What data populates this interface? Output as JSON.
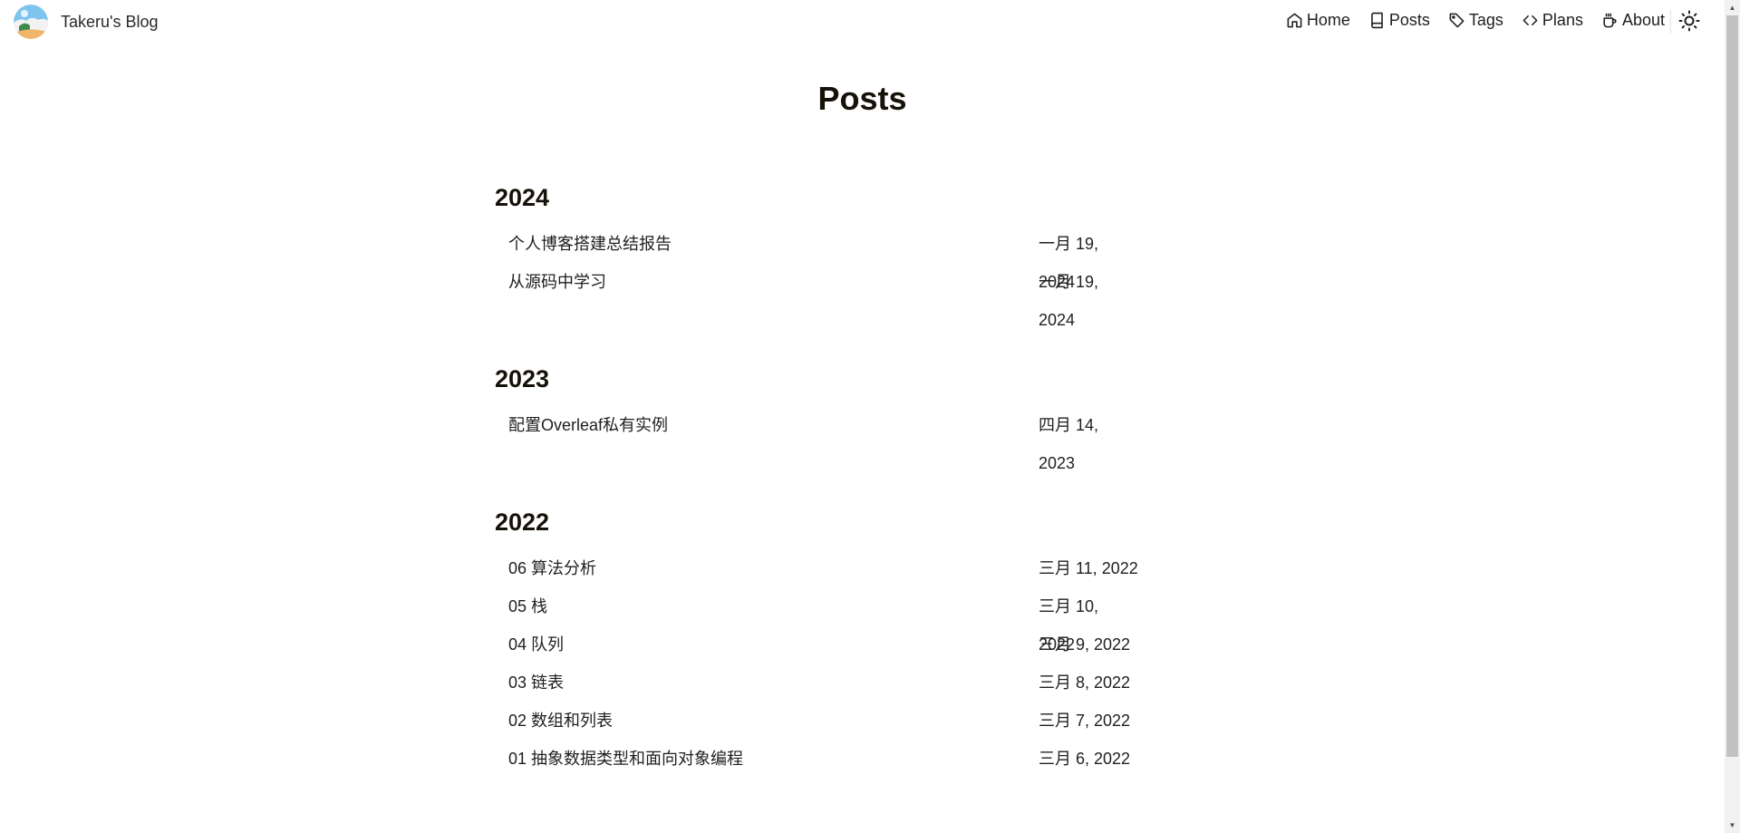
{
  "site": {
    "title": "Takeru's Blog",
    "avatar_icon": "avatar-image"
  },
  "nav": {
    "items": [
      {
        "label": "Home",
        "icon": "home-icon"
      },
      {
        "label": "Posts",
        "icon": "book-icon"
      },
      {
        "label": "Tags",
        "icon": "tag-icon"
      },
      {
        "label": "Plans",
        "icon": "code-icon"
      },
      {
        "label": "About",
        "icon": "coffee-icon"
      }
    ],
    "theme_toggle_icon": "sun-icon"
  },
  "main": {
    "title": "Posts",
    "years": [
      {
        "year": "2024",
        "posts": [
          {
            "title": "个人博客搭建总结报告",
            "date": "一月 19, 2024"
          },
          {
            "title": "从源码中学习",
            "date": "一月 19, 2024"
          }
        ]
      },
      {
        "year": "2023",
        "posts": [
          {
            "title": "配置Overleaf私有实例",
            "date": "四月 14, 2023"
          }
        ]
      },
      {
        "year": "2022",
        "posts": [
          {
            "title": "06 算法分析",
            "date": "三月 11, 2022"
          },
          {
            "title": "05 栈",
            "date": "三月 10, 2022"
          },
          {
            "title": "04 队列",
            "date": "三月 9, 2022"
          },
          {
            "title": "03 链表",
            "date": "三月 8, 2022"
          },
          {
            "title": "02 数组和列表",
            "date": "三月 7, 2022"
          },
          {
            "title": "01 抽象数据类型和面向对象编程",
            "date": "三月 6, 2022"
          }
        ]
      }
    ]
  },
  "colors": {
    "text": "#161209",
    "background": "#ffffff"
  }
}
